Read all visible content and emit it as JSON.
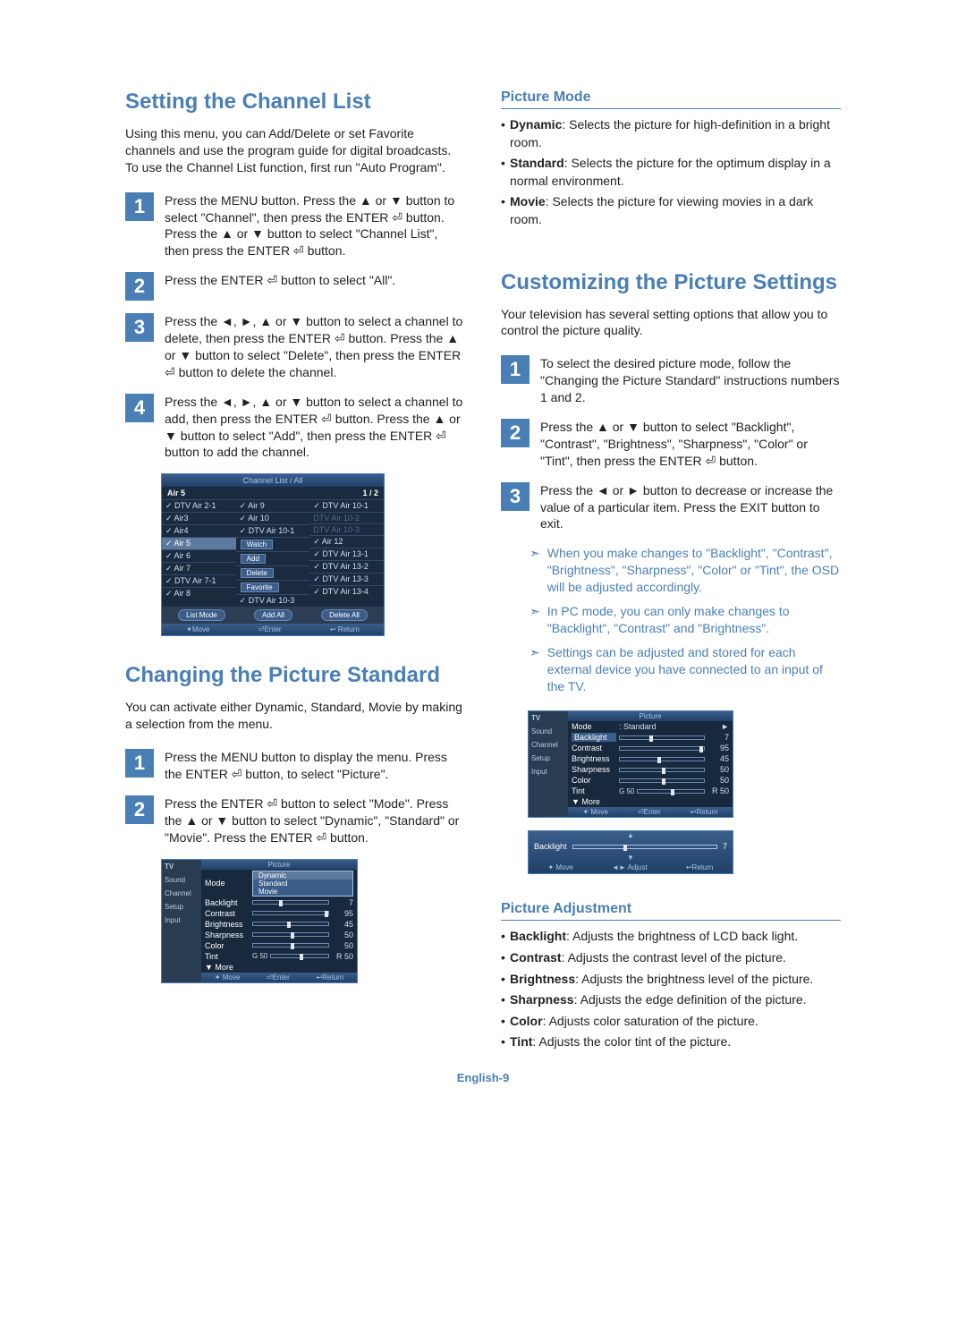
{
  "page_number": "English-9",
  "left": {
    "h1a": "Setting the Channel List",
    "intro": "Using this menu, you can Add/Delete or set Favorite channels and use the program guide for digital broadcasts. To use the Channel List function, first run \"Auto Program\".",
    "step1": "Press the MENU button. Press the ▲ or ▼ button to select \"Channel\", then press the ENTER ⏎ button. Press the ▲ or ▼ button to select \"Channel List\", then press the ENTER ⏎ button.",
    "step2": "Press the ENTER ⏎ button to select \"All\".",
    "step3": "Press the ◄, ►, ▲ or ▼ button to select a channel to delete, then press the ENTER ⏎ button. Press the ▲ or ▼ button to select \"Delete\", then press the ENTER ⏎ button to delete the channel.",
    "step4": "Press the ◄, ►, ▲ or ▼ button to select a channel to add, then press the ENTER ⏎ button. Press the ▲ or ▼ button to select \"Add\", then press the ENTER ⏎ button to add the channel.",
    "osd_channel": {
      "title": "Channel List / All",
      "air": "Air 5",
      "page": "1 / 2",
      "col1": [
        "✓ DTV Air 2-1",
        "✓ Air3",
        "✓ Air4",
        "✓ Air 5",
        "✓ Air 6",
        "✓ Air 7",
        "✓ DTV Air 7-1",
        "✓ Air 8"
      ],
      "col2": [
        "✓ Air 9",
        "✓ Air 10",
        "✓ DTV Air 10-1",
        "Watch",
        "Add",
        "Delete",
        "Favorite",
        "✓ DTV Air 10-3"
      ],
      "col3": [
        "✓ DTV Air 10-1",
        "DTV Air 10-2",
        "DTV Air 10-3",
        "✓ Air 12",
        "✓ DTV Air 13-1",
        "✓ DTV Air 13-2",
        "✓ DTV Air 13-3",
        "✓ DTV Air 13-4"
      ],
      "btns": [
        "List Mode",
        "Add All",
        "Delete All"
      ],
      "footer": [
        "✦Move",
        "⏎Enter",
        "↩ Return"
      ]
    },
    "h1b": "Changing the Picture Standard",
    "intro2": "You can activate either Dynamic, Standard, Movie by making a selection from the menu.",
    "step1b": "Press the MENU button to display the menu. Press the ENTER ⏎ button, to select \"Picture\".",
    "step2b": "Press the ENTER ⏎ button to select \"Mode\". Press the ▲ or ▼ button to select \"Dynamic\", \"Standard\" or \"Movie\". Press the ENTER ⏎ button.",
    "osd_pic1": {
      "title": "Picture",
      "tv": "TV",
      "side": [
        "",
        "Sound",
        "Channel",
        "Setup",
        "Input"
      ],
      "mode_label": "Mode",
      "rows": [
        {
          "l": "Backlight",
          "v": "7",
          "p": 35
        },
        {
          "l": "Contrast",
          "v": "95",
          "p": 95
        },
        {
          "l": "Brightness",
          "v": "45",
          "p": 45
        },
        {
          "l": "Sharpness",
          "v": "50",
          "p": 50
        },
        {
          "l": "Color",
          "v": "50",
          "p": 50
        },
        {
          "l": "Tint",
          "pre": "G 50",
          "v": "R 50",
          "p": 50
        }
      ],
      "more": "▼ More",
      "dropdown": [
        "Dynamic",
        "Standard",
        "Movie"
      ],
      "footer": [
        "✦ Move",
        "⏎Enter",
        "↩Return"
      ]
    }
  },
  "right": {
    "h2a": "Picture Mode",
    "pm_items": [
      {
        "b": "Dynamic",
        "t": ": Selects the picture for high-definition in a bright room."
      },
      {
        "b": "Standard",
        "t": ": Selects the picture for the optimum display in a normal environment."
      },
      {
        "b": "Movie",
        "t": ": Selects the picture for viewing movies in a dark room."
      }
    ],
    "h1c": "Customizing the Picture Settings",
    "intro3": "Your television has several setting options that allow you to control the picture quality.",
    "step1c": "To select the desired picture mode, follow the \"Changing the Picture Standard\" instructions numbers 1 and 2.",
    "step2c": "Press the ▲ or ▼ button to select \"Backlight\", \"Contrast\", \"Brightness\", \"Sharpness\", \"Color\" or \"Tint\", then press the ENTER ⏎ button.",
    "step3c": "Press the ◄ or ► button to decrease or increase the value of a particular item. Press the EXIT button to exit.",
    "notes": [
      "When you make changes to \"Backlight\", \"Contrast\", \"Brightness\", \"Sharpness\", \"Color\" or \"Tint\", the OSD will be adjusted accordingly.",
      "In PC mode, you can only make changes to \"Backlight\", \"Contrast\" and \"Brightness\".",
      "Settings can be adjusted and stored for each external device you have connected to an input of the TV."
    ],
    "osd_pic2": {
      "title": "Picture",
      "tv": "TV",
      "side": [
        "",
        "Sound",
        "Channel",
        "Setup",
        "Input"
      ],
      "mode_label": "Mode",
      "mode_val": ": Standard",
      "sel": "Backlight",
      "rows": [
        {
          "l": "Backlight",
          "v": "7",
          "p": 35,
          "sel": true
        },
        {
          "l": "Contrast",
          "v": "95",
          "p": 95
        },
        {
          "l": "Brightness",
          "v": "45",
          "p": 45
        },
        {
          "l": "Sharpness",
          "v": "50",
          "p": 50
        },
        {
          "l": "Color",
          "v": "50",
          "p": 50
        },
        {
          "l": "Tint",
          "pre": "G 50",
          "v": "R 50",
          "p": 50
        }
      ],
      "more": "▼ More",
      "footer": [
        "✦ Move",
        "⏎Enter",
        "↩Return"
      ]
    },
    "osd_small": {
      "label": "Backlight",
      "value": "7",
      "p": 35,
      "footer": [
        "✦ Move",
        "◄► Adjust",
        "↩Return"
      ]
    },
    "h2b": "Picture Adjustment",
    "pa_items": [
      {
        "b": "Backlight",
        "t": ": Adjusts the brightness of LCD back light."
      },
      {
        "b": "Contrast",
        "t": ": Adjusts the contrast level of the picture."
      },
      {
        "b": "Brightness",
        "t": ": Adjusts the brightness level of the picture."
      },
      {
        "b": "Sharpness",
        "t": ": Adjusts the edge definition of the picture."
      },
      {
        "b": "Color",
        "t": ": Adjusts color saturation of the picture."
      },
      {
        "b": "Tint",
        "t": ": Adjusts the color tint of the picture."
      }
    ]
  }
}
